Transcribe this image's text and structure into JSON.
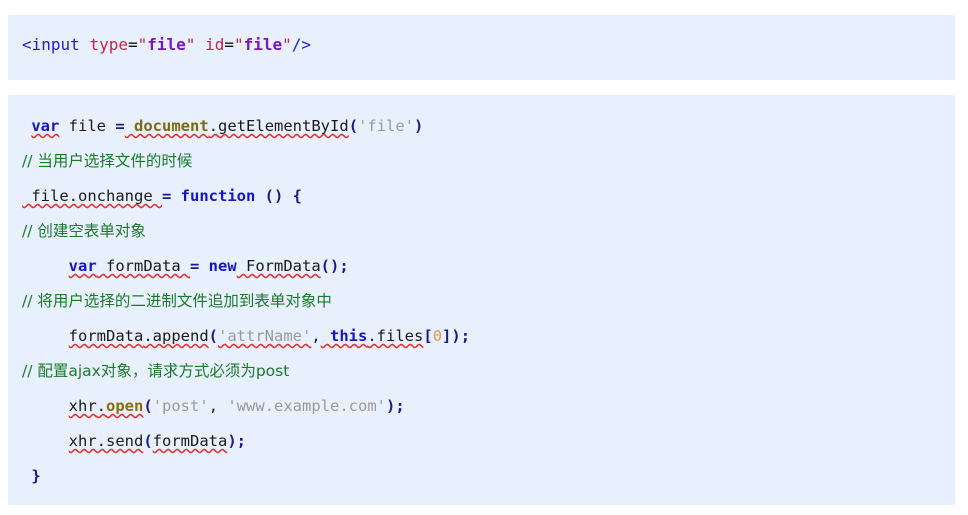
{
  "page": {
    "background_color": "#ffffff",
    "code_block_background": "#e8f0fd"
  },
  "colors": {
    "tag": "#2222cc",
    "attribute": "#cc2244",
    "attribute_value": "#7a15c4",
    "keyword": "#1414c8",
    "punctuation": "#1a1a8c",
    "global_object": "#7a6a10",
    "method": "#8a6d0b",
    "string": "#9a9a9a",
    "comment": "#1a7a2a",
    "number": "#d69a52",
    "squiggle": "#e03030"
  },
  "blocks": [
    {
      "id": "html-snippet",
      "language": "html",
      "lines": [
        {
          "id": "html-line-1",
          "text": "<input type=\"file\" id=\"file\"/>",
          "tokens": [
            {
              "text": "<input",
              "type": "tag"
            },
            {
              "text": " ",
              "type": "plain"
            },
            {
              "text": "type",
              "type": "attribute"
            },
            {
              "text": "=",
              "type": "plain"
            },
            {
              "text": "\"",
              "type": "quote"
            },
            {
              "text": "file",
              "type": "attribute_value"
            },
            {
              "text": "\"",
              "type": "quote"
            },
            {
              "text": " ",
              "type": "plain"
            },
            {
              "text": "id",
              "type": "attribute"
            },
            {
              "text": "=",
              "type": "plain"
            },
            {
              "text": "\"",
              "type": "quote"
            },
            {
              "text": "file",
              "type": "attribute_value"
            },
            {
              "text": "\"",
              "type": "quote"
            },
            {
              "text": "/>",
              "type": "tag"
            }
          ]
        }
      ]
    },
    {
      "id": "js-snippet",
      "language": "javascript",
      "lines": [
        {
          "id": "js-line-1",
          "text": " var file = document.getElementById('file')"
        },
        {
          "id": "js-line-2",
          "text": "// 当用户选择文件的时候"
        },
        {
          "id": "js-line-3",
          "text": " file.onchange = function () {"
        },
        {
          "id": "js-line-4",
          "text": "     // 创建空表单对象"
        },
        {
          "id": "js-line-5",
          "text": "     var formData = new FormData();"
        },
        {
          "id": "js-line-6",
          "text": "     // 将用户选择的二进制文件追加到表单对象中"
        },
        {
          "id": "js-line-7",
          "text": "     formData.append('attrName', this.files[0]);"
        },
        {
          "id": "js-line-8",
          "text": "     // 配置ajax对象，请求方式必须为post"
        },
        {
          "id": "js-line-9",
          "text": "     xhr.open('post', 'www.example.com');"
        },
        {
          "id": "js-line-10",
          "text": "     xhr.send(formData);"
        },
        {
          "id": "js-line-11",
          "text": " }"
        }
      ],
      "segments": {
        "line1": {
          "kw_var": "var",
          "ident_file": " file ",
          "op_eq": "=",
          "global_document": " document",
          "dot": ".",
          "method_get": "getElementById",
          "paren_open": "(",
          "string_file": "'file'",
          "paren_close": ")"
        },
        "line2": {
          "comment": "// 当用户选择文件的时候"
        },
        "line3": {
          "ident_fileonchange": " file.onchange ",
          "op_eq": "=",
          "kw_function": " function",
          "parens": " ()",
          "brace_open": " {"
        },
        "line4": {
          "comment": "// 创建空表单对象"
        },
        "line5": {
          "kw_var": "var",
          "ident_formdata": " formData ",
          "op_eq": "=",
          "kw_new": " new",
          "ident_FormData": " FormData",
          "punc_tail": "();"
        },
        "line6": {
          "comment": "// 将用户选择的二进制文件追加到表单对象中"
        },
        "line7": {
          "ident_formdata": "formData",
          "dot_append": ".append",
          "paren_open": "(",
          "string_attrname": "'attrName'",
          "comma": ",",
          "kw_this": " this",
          "ident_files": ".files",
          "bracket_open": "[",
          "number_zero": "0",
          "bracket_close": "]",
          "paren_close": ")",
          "semicolon": ";"
        },
        "line8": {
          "comment": "// 配置ajax对象，请求方式必须为post"
        },
        "line9": {
          "ident_xhr": "xhr",
          "dot": ".",
          "method_open": "open",
          "paren_open": "(",
          "string_post": "'post'",
          "comma": ",",
          "string_url": " 'www.example.com'",
          "paren_close": ")",
          "semicolon": ";"
        },
        "line10": {
          "ident_xhrsend": "xhr.send",
          "paren_open": "(",
          "ident_formdata": "formData",
          "paren_close": ")",
          "semicolon": ";"
        },
        "line11": {
          "brace_close": " }"
        }
      }
    }
  ]
}
